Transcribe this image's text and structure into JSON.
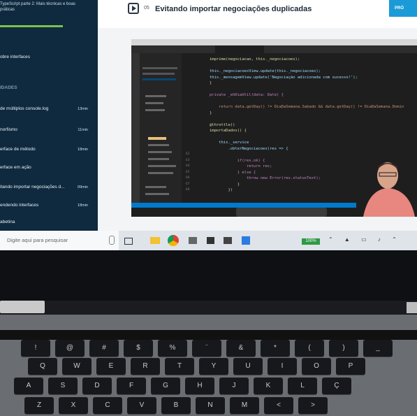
{
  "sidebar": {
    "course_title": "TypeScript parte 2: Mais técnicas e boas práticas",
    "items": [
      {
        "label": "obre interfaces",
        "duration": ""
      },
      {
        "label": "IDADES",
        "duration": ""
      },
      {
        "label": "de múltiplos console.log",
        "duration": "13min"
      },
      {
        "label": "norfismo",
        "duration": "11min"
      },
      {
        "label": "erface de método",
        "duration": "18min"
      },
      {
        "label": "erface em ação",
        "duration": ""
      },
      {
        "label": "itando importar negociações d...",
        "duration": "09min"
      },
      {
        "label": "endendo interfaces",
        "duration": "18min"
      },
      {
        "label": "abetina",
        "duration": ""
      }
    ]
  },
  "lesson": {
    "number": "05",
    "title": "Evitando importar negociações duplicadas",
    "next_label": "PRÓ"
  },
  "editor": {
    "lines": [
      {
        "n": "",
        "t": "imprime(negociacao, this._negociacoes);"
      },
      {
        "n": "",
        "t": ""
      },
      {
        "n": "",
        "t": "this._negociacoesView.update(this._negociacoes);"
      },
      {
        "n": "",
        "t": "this._mensagemView.update('Negociação adicionada com sucesso!');"
      },
      {
        "n": "",
        "t": "}"
      },
      {
        "n": "",
        "t": ""
      },
      {
        "n": "",
        "t": "private _ehDiaUtil(data: Date) {"
      },
      {
        "n": "",
        "t": ""
      },
      {
        "n": "",
        "t": "    return data.getDay() != DiaDaSemana.Sabado && data.getDay() != DiaDaSemana.Domin"
      },
      {
        "n": "",
        "t": "}"
      },
      {
        "n": "",
        "t": ""
      },
      {
        "n": "",
        "t": "@throttle()"
      },
      {
        "n": "",
        "t": "importaDados() {"
      },
      {
        "n": "",
        "t": ""
      },
      {
        "n": "",
        "t": "    this._service"
      },
      {
        "n": "",
        "t": "        .obterNegociacoes(res => {"
      },
      {
        "n": "62",
        "t": ""
      },
      {
        "n": "63",
        "t": "            if(res.ok) {"
      },
      {
        "n": "64",
        "t": "                return res;"
      },
      {
        "n": "65",
        "t": "            } else {"
      },
      {
        "n": "66",
        "t": "                throw new Error(res.statusText);"
      },
      {
        "n": "67",
        "t": "            }"
      },
      {
        "n": "68",
        "t": "        })"
      }
    ]
  },
  "taskbar": {
    "search_placeholder": "Digite aqui para pesquisar",
    "battery": "100%"
  },
  "keyboard": {
    "row1": [
      "!",
      "@",
      "#",
      "$",
      "%",
      "¨",
      "&",
      "*",
      "(",
      ")",
      "_"
    ],
    "row2": [
      "Q",
      "W",
      "E",
      "R",
      "T",
      "Y",
      "U",
      "I",
      "O",
      "P"
    ],
    "row3": [
      "A",
      "S",
      "D",
      "F",
      "G",
      "H",
      "J",
      "K",
      "L",
      "Ç"
    ],
    "row4": [
      "Z",
      "X",
      "C",
      "V",
      "B",
      "N",
      "M",
      "<",
      ">"
    ]
  }
}
